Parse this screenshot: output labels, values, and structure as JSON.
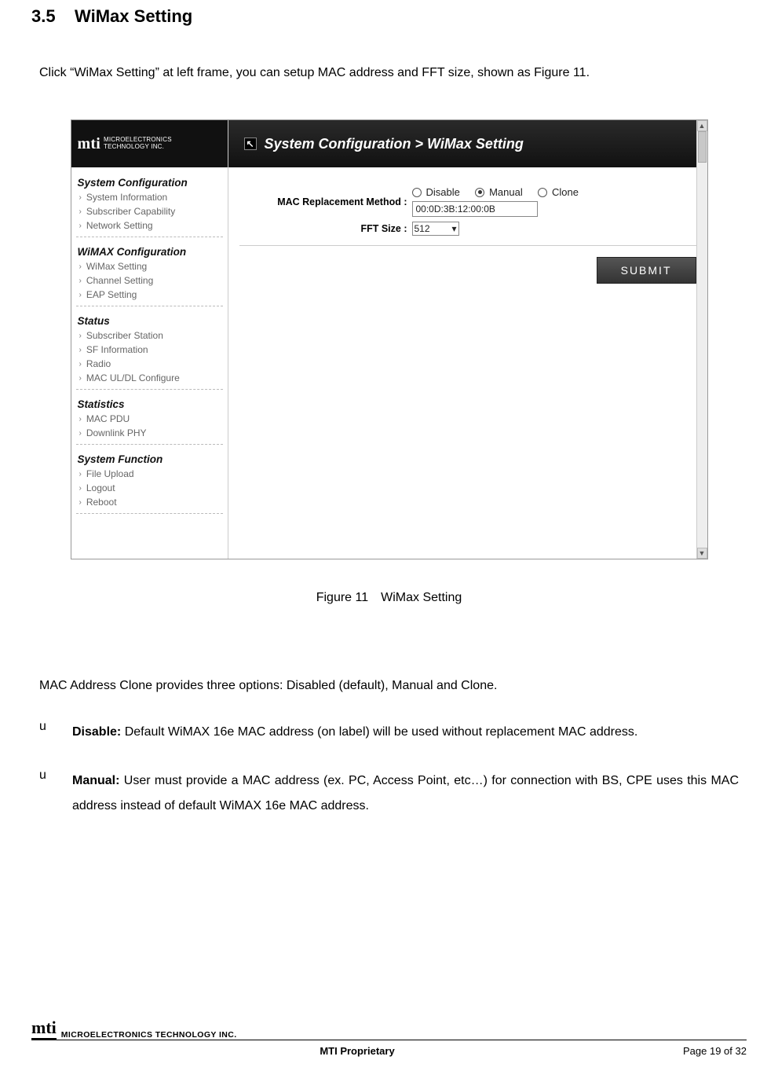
{
  "doc": {
    "section_number": "3.5",
    "section_title": "WiMax Setting",
    "intro": "Click “WiMax Setting” at left frame, you can setup MAC address and FFT size, shown as Figure 11.",
    "figure_caption": "Figure 11 WiMax Setting",
    "paragraph": "MAC Address Clone provides three options: Disabled (default), Manual and Clone.",
    "bullets": [
      {
        "marker": "u",
        "bold": "Disable:",
        "rest": " Default WiMAX 16e MAC address (on label) will be used without replacement MAC address."
      },
      {
        "marker": "u",
        "bold": "Manual:",
        "rest": " User must provide a MAC address (ex. PC, Access Point, etc…) for connection with BS, CPE uses this MAC address instead of default WiMAX 16e MAC address."
      }
    ]
  },
  "app": {
    "logo_line1": "MICROELECTRONICS",
    "logo_line2": "TECHNOLOGY INC.",
    "breadcrumb": "System Configuration > WiMax Setting",
    "sidebar": [
      {
        "title": "System Configuration",
        "items": [
          "System Information",
          "Subscriber Capability",
          "Network Setting"
        ]
      },
      {
        "title": "WiMAX Configuration",
        "items": [
          "WiMax Setting",
          "Channel Setting",
          "EAP Setting"
        ]
      },
      {
        "title": "Status",
        "items": [
          "Subscriber Station",
          "SF Information",
          "Radio",
          "MAC UL/DL Configure"
        ]
      },
      {
        "title": "Statistics",
        "items": [
          "MAC PDU",
          "Downlink PHY"
        ]
      },
      {
        "title": "System Function",
        "items": [
          "File Upload",
          "Logout",
          "Reboot"
        ]
      }
    ],
    "form": {
      "mac_label": "MAC Replacement Method :",
      "radios": [
        "Disable",
        "Manual",
        "Clone"
      ],
      "radio_selected_index": 1,
      "mac_value": "00:0D:3B:12:00:0B",
      "fft_label": "FFT Size :",
      "fft_value": "512",
      "submit": "SUBMIT"
    }
  },
  "footer": {
    "company": "MICROELECTRONICS TECHNOLOGY INC.",
    "center": "MTI Proprietary",
    "page": "Page 19 of 32"
  }
}
